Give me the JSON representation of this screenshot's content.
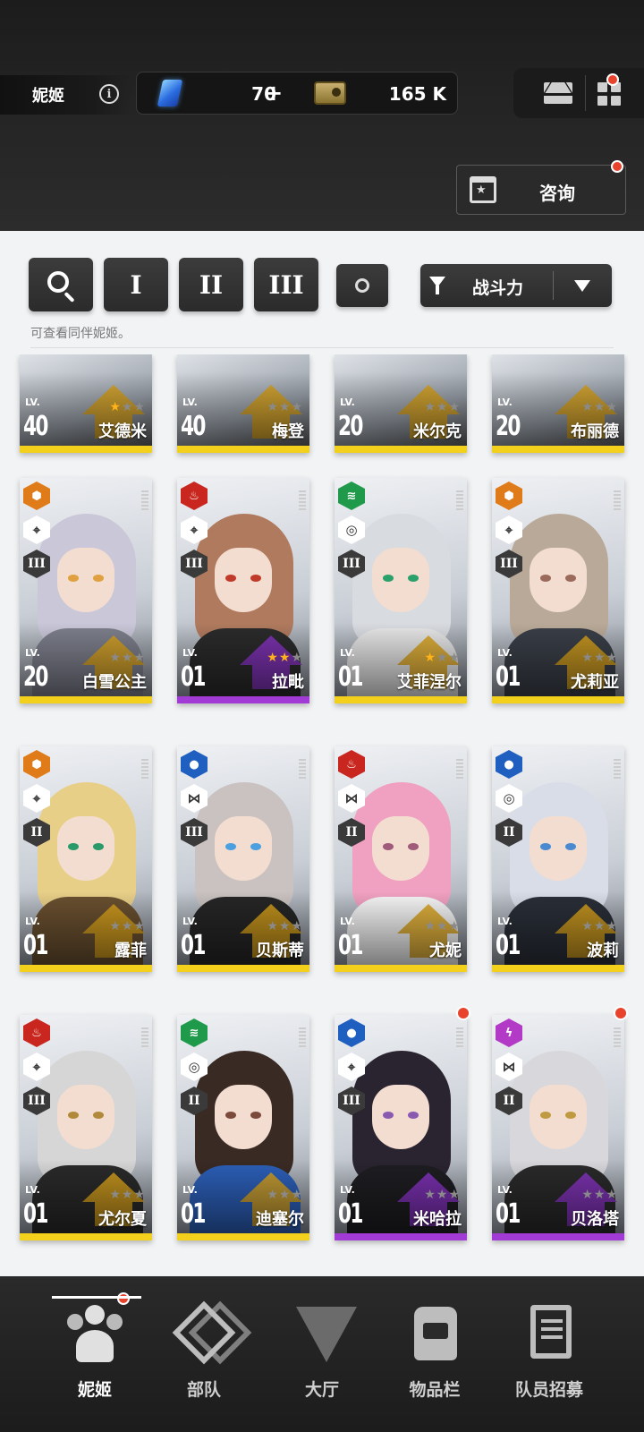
{
  "header": {
    "player_name": "妮姬",
    "gems": "70",
    "gems_plus": "+",
    "credits": "165 K",
    "consult_label": "咨询"
  },
  "filters": {
    "burst_1": "I",
    "burst_2": "II",
    "burst_3": "III",
    "sort_label": "战斗力",
    "hint": "可查看同伴妮姬。"
  },
  "level_label": "LV.",
  "characters": [
    {
      "name": "艾德米",
      "level": "40",
      "stars_on": 1,
      "rarity": "SSR",
      "emblem_color": "#d9a21b"
    },
    {
      "name": "梅登",
      "level": "40",
      "stars_on": 0,
      "rarity": "SSR",
      "emblem_color": "#d9a21b"
    },
    {
      "name": "米尔克",
      "level": "20",
      "stars_on": 0,
      "rarity": "SSR",
      "emblem_color": "#d9a21b"
    },
    {
      "name": "布丽德",
      "level": "20",
      "stars_on": 0,
      "rarity": "SSR",
      "emblem_color": "#d9a21b"
    },
    {
      "name": "白雪公主",
      "level": "20",
      "stars_on": 0,
      "rarity": "SSR",
      "element": "iron",
      "weapon": "crosshair",
      "burst": "III",
      "element_color": "#e07b1a",
      "hair": "#c9c7d8",
      "body": "#7d7f8c",
      "eye": "#e0a040",
      "emblem_color": "#d9a21b"
    },
    {
      "name": "拉毗",
      "level": "01",
      "stars_on": 2,
      "rarity": "SR",
      "element": "fire",
      "weapon": "crosshair",
      "burst": "III",
      "element_color": "#c8261e",
      "hair": "#b07a5e",
      "body": "#2b2b2b",
      "eye": "#c03a2a",
      "emblem_color": "#8a34c7"
    },
    {
      "name": "艾菲涅尔",
      "level": "01",
      "stars_on": 1,
      "rarity": "SSR",
      "element": "wind",
      "weapon": "circle",
      "burst": "III",
      "element_color": "#1f9a4a",
      "hair": "#d8dbe0",
      "body": "#e6e6e6",
      "eye": "#2aa06a",
      "emblem_color": "#d9a21b"
    },
    {
      "name": "尤莉亚",
      "level": "01",
      "stars_on": 0,
      "rarity": "SSR",
      "element": "iron",
      "weapon": "crosshair",
      "burst": "III",
      "element_color": "#e07b1a",
      "hair": "#b9a998",
      "body": "#3a3f48",
      "eye": "#9a6a5a",
      "emblem_color": "#d9a21b"
    },
    {
      "name": "露菲",
      "level": "01",
      "stars_on": 0,
      "rarity": "SSR",
      "element": "iron",
      "weapon": "crosshair",
      "burst": "II",
      "element_color": "#e07b1a",
      "hair": "#e8cf88",
      "body": "#6a5030",
      "eye": "#2a9a6a",
      "emblem_color": "#d9a21b"
    },
    {
      "name": "贝斯蒂",
      "level": "01",
      "stars_on": 0,
      "rarity": "SSR",
      "element": "water",
      "weapon": "split",
      "burst": "III",
      "element_color": "#1f5fbf",
      "hair": "#c9c2c0",
      "body": "#262626",
      "eye": "#4aa0e0",
      "emblem_color": "#d9a21b"
    },
    {
      "name": "尤妮",
      "level": "01",
      "stars_on": 0,
      "rarity": "SSR",
      "element": "fire",
      "weapon": "split",
      "burst": "II",
      "element_color": "#c8261e",
      "hair": "#f0a0c0",
      "body": "#f5f5f5",
      "eye": "#a05a7a",
      "emblem_color": "#d9a21b"
    },
    {
      "name": "波莉",
      "level": "01",
      "stars_on": 0,
      "rarity": "SSR",
      "element": "water",
      "weapon": "circle",
      "burst": "II",
      "element_color": "#1f5fbf",
      "hair": "#d8dde8",
      "body": "#2a2f38",
      "eye": "#4a8ad0",
      "emblem_color": "#d9a21b"
    },
    {
      "name": "尤尔夏",
      "level": "01",
      "stars_on": 0,
      "rarity": "SSR",
      "element": "fire",
      "weapon": "crosshair",
      "burst": "III",
      "element_color": "#c8261e",
      "hair": "#d6d6d6",
      "body": "#2a2a2a",
      "eye": "#b08a3a",
      "emblem_color": "#d9a21b"
    },
    {
      "name": "迪塞尔",
      "level": "01",
      "stars_on": 0,
      "rarity": "SSR",
      "element": "wind",
      "weapon": "circle",
      "burst": "II",
      "element_color": "#1f9a4a",
      "hair": "#3a2a24",
      "body": "#2c5fb8",
      "eye": "#7a4a3a",
      "emblem_color": "#d9a21b"
    },
    {
      "name": "米哈拉",
      "level": "01",
      "stars_on": 0,
      "rarity": "SR",
      "element": "water",
      "weapon": "crosshair",
      "burst": "III",
      "element_color": "#1f5fbf",
      "hair": "#2a2430",
      "body": "#1e1e22",
      "eye": "#8a5ab0",
      "emblem_color": "#8a34c7",
      "new": true
    },
    {
      "name": "贝洛塔",
      "level": "01",
      "stars_on": 0,
      "rarity": "SR",
      "element": "electric",
      "weapon": "split",
      "burst": "II",
      "element_color": "#b23ac6",
      "hair": "#d8d8dc",
      "body": "#2a2a2a",
      "eye": "#c09a40",
      "emblem_color": "#8a34c7",
      "new": true
    }
  ],
  "nav": [
    {
      "label": "妮姬",
      "active": true
    },
    {
      "label": "部队"
    },
    {
      "label": "大厅"
    },
    {
      "label": "物品栏"
    },
    {
      "label": "队员招募"
    }
  ]
}
